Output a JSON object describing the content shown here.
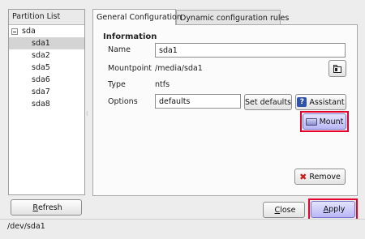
{
  "partition_list": {
    "header": "Partition List",
    "root": "sda",
    "items": [
      "sda1",
      "sda2",
      "sda5",
      "sda6",
      "sda7",
      "sda8"
    ],
    "selected": "sda1"
  },
  "buttons": {
    "refresh_pre": "",
    "refresh_u": "R",
    "refresh_post": "efresh",
    "close_pre": "",
    "close_u": "C",
    "close_post": "lose",
    "apply_pre": "",
    "apply_u": "A",
    "apply_post": "pply"
  },
  "tabs": [
    "General Configuration",
    "Dynamic configuration rules"
  ],
  "information": {
    "heading": "Information",
    "name_label": "Name",
    "name_value": "sda1",
    "mountpoint_label": "Mountpoint",
    "mountpoint_value": "/media/sda1",
    "type_label": "Type",
    "type_value": "ntfs",
    "options_label": "Options",
    "options_value": "defaults",
    "set_defaults": "Set defaults",
    "assistant": "Assistant",
    "mount": "Mount",
    "remove": "Remove"
  },
  "icons": {
    "help": "?",
    "remove": "✖"
  },
  "status": "/dev/sda1",
  "colors": {
    "highlight_box": "#e4002b",
    "primary_button": "#b9b7f6",
    "selected_row": "#d4d4d4"
  }
}
